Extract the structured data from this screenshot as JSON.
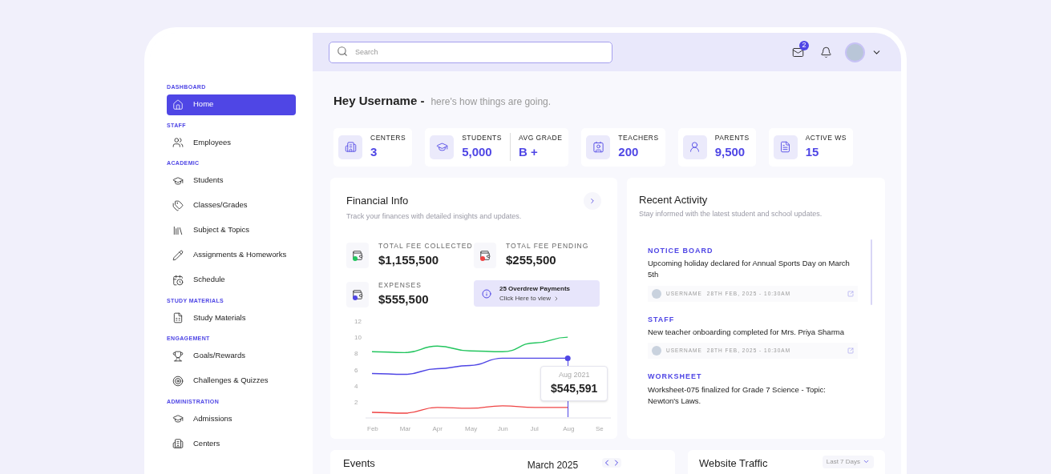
{
  "sidebar": {
    "sections": [
      {
        "title": "DASHBOARD",
        "items": [
          {
            "label": "Home",
            "selected": true
          }
        ]
      },
      {
        "title": "STAFF",
        "items": [
          {
            "label": "Employees",
            "selected": false
          }
        ]
      },
      {
        "title": "ACADEMIC",
        "items": [
          {
            "label": "Students",
            "selected": false
          },
          {
            "label": "Classes/Grades",
            "selected": false
          },
          {
            "label": "Subject & Topics",
            "selected": false
          },
          {
            "label": "Assignments & Homeworks",
            "selected": false
          },
          {
            "label": "Schedule",
            "selected": false
          }
        ]
      },
      {
        "title": "STUDY MATERIALS",
        "items": [
          {
            "label": "Study Materials",
            "selected": false
          }
        ]
      },
      {
        "title": "ENGAGEMENT",
        "items": [
          {
            "label": "Goals/Rewards",
            "selected": false
          },
          {
            "label": "Challenges & Quizzes",
            "selected": false
          }
        ]
      },
      {
        "title": "ADMINISTRATION",
        "items": [
          {
            "label": "Admissions",
            "selected": false
          },
          {
            "label": "Centers",
            "selected": false
          }
        ]
      }
    ]
  },
  "topbar": {
    "search": {
      "placeholder": "Search"
    },
    "mail_badge": "2"
  },
  "greeting": {
    "title": "Hey Username -",
    "subtitle": "here's how things are going."
  },
  "stats": [
    {
      "items": [
        {
          "label": "CENTERS",
          "value": "3"
        }
      ]
    },
    {
      "items": [
        {
          "label": "STUDENTS",
          "value": "5,000"
        },
        {
          "label": "AVG GRADE",
          "value": "B +"
        }
      ]
    },
    {
      "items": [
        {
          "label": "TEACHERS",
          "value": "200"
        }
      ]
    },
    {
      "items": [
        {
          "label": "PARENTS",
          "value": "9,500"
        }
      ]
    },
    {
      "items": [
        {
          "label": "ACTIVE WS",
          "value": "15"
        }
      ]
    }
  ],
  "financial": {
    "title": "Financial Info",
    "subtitle": "Track your finances with detailed insights and updates.",
    "metrics": [
      {
        "label": "TOTAL FEE COLLECTED",
        "value": "$1,155,500",
        "color": "#22c55e"
      },
      {
        "label": "TOTAL FEE PENDING",
        "value": "$255,500",
        "color": "#ef4444"
      },
      {
        "label": "EXPENSES",
        "value": "$555,500",
        "color": "#4f46e5"
      }
    ],
    "alert": {
      "title": "25 Overdrew Payments",
      "link": "Click Here to view"
    },
    "chart_data": {
      "type": "line",
      "categories": [
        "Feb",
        "Mar",
        "Apr",
        "May",
        "Jun",
        "Jul",
        "Aug",
        "Se"
      ],
      "yticks": [
        2,
        4,
        6,
        8,
        10,
        12
      ],
      "ylim": [
        0,
        12
      ],
      "series": [
        {
          "color": "#22c55e",
          "values": [
            8.2,
            8.1,
            8.9,
            8.3,
            8.2,
            9.3,
            10,
            null
          ]
        },
        {
          "color": "#4f46e5",
          "values": [
            5.5,
            5.4,
            6.1,
            6.5,
            7.4,
            7.4,
            7.4,
            null
          ]
        },
        {
          "color": "#ef4444",
          "values": [
            0.7,
            0.6,
            1.3,
            1.2,
            1.5,
            1.3,
            1.3,
            null
          ]
        }
      ]
    },
    "tooltip": {
      "title": "Aug 2021",
      "value": "$545,591"
    }
  },
  "activity": {
    "title": "Recent Activity",
    "subtitle": "Stay informed with the latest student and school updates.",
    "items": [
      {
        "category": "NOTICE BOARD",
        "text": "Upcoming holiday declared for Annual Sports Day on March 5th",
        "user": "USERNAME",
        "time": "28TH FEB, 2025 - 10:30AM"
      },
      {
        "category": "STAFF",
        "text": "New teacher onboarding completed for Mrs. Priya Sharma",
        "user": "USERNAME",
        "time": "28TH FEB, 2025 - 10:30AM"
      },
      {
        "category": "WORKSHEET",
        "text": "Worksheet-075 finalized for Grade 7 Science  - Topic: Newton's Laws."
      }
    ]
  },
  "events": {
    "title": "Events",
    "month": "March 2025"
  },
  "traffic": {
    "title": "Website Traffic",
    "range": "Last 7 Days"
  }
}
